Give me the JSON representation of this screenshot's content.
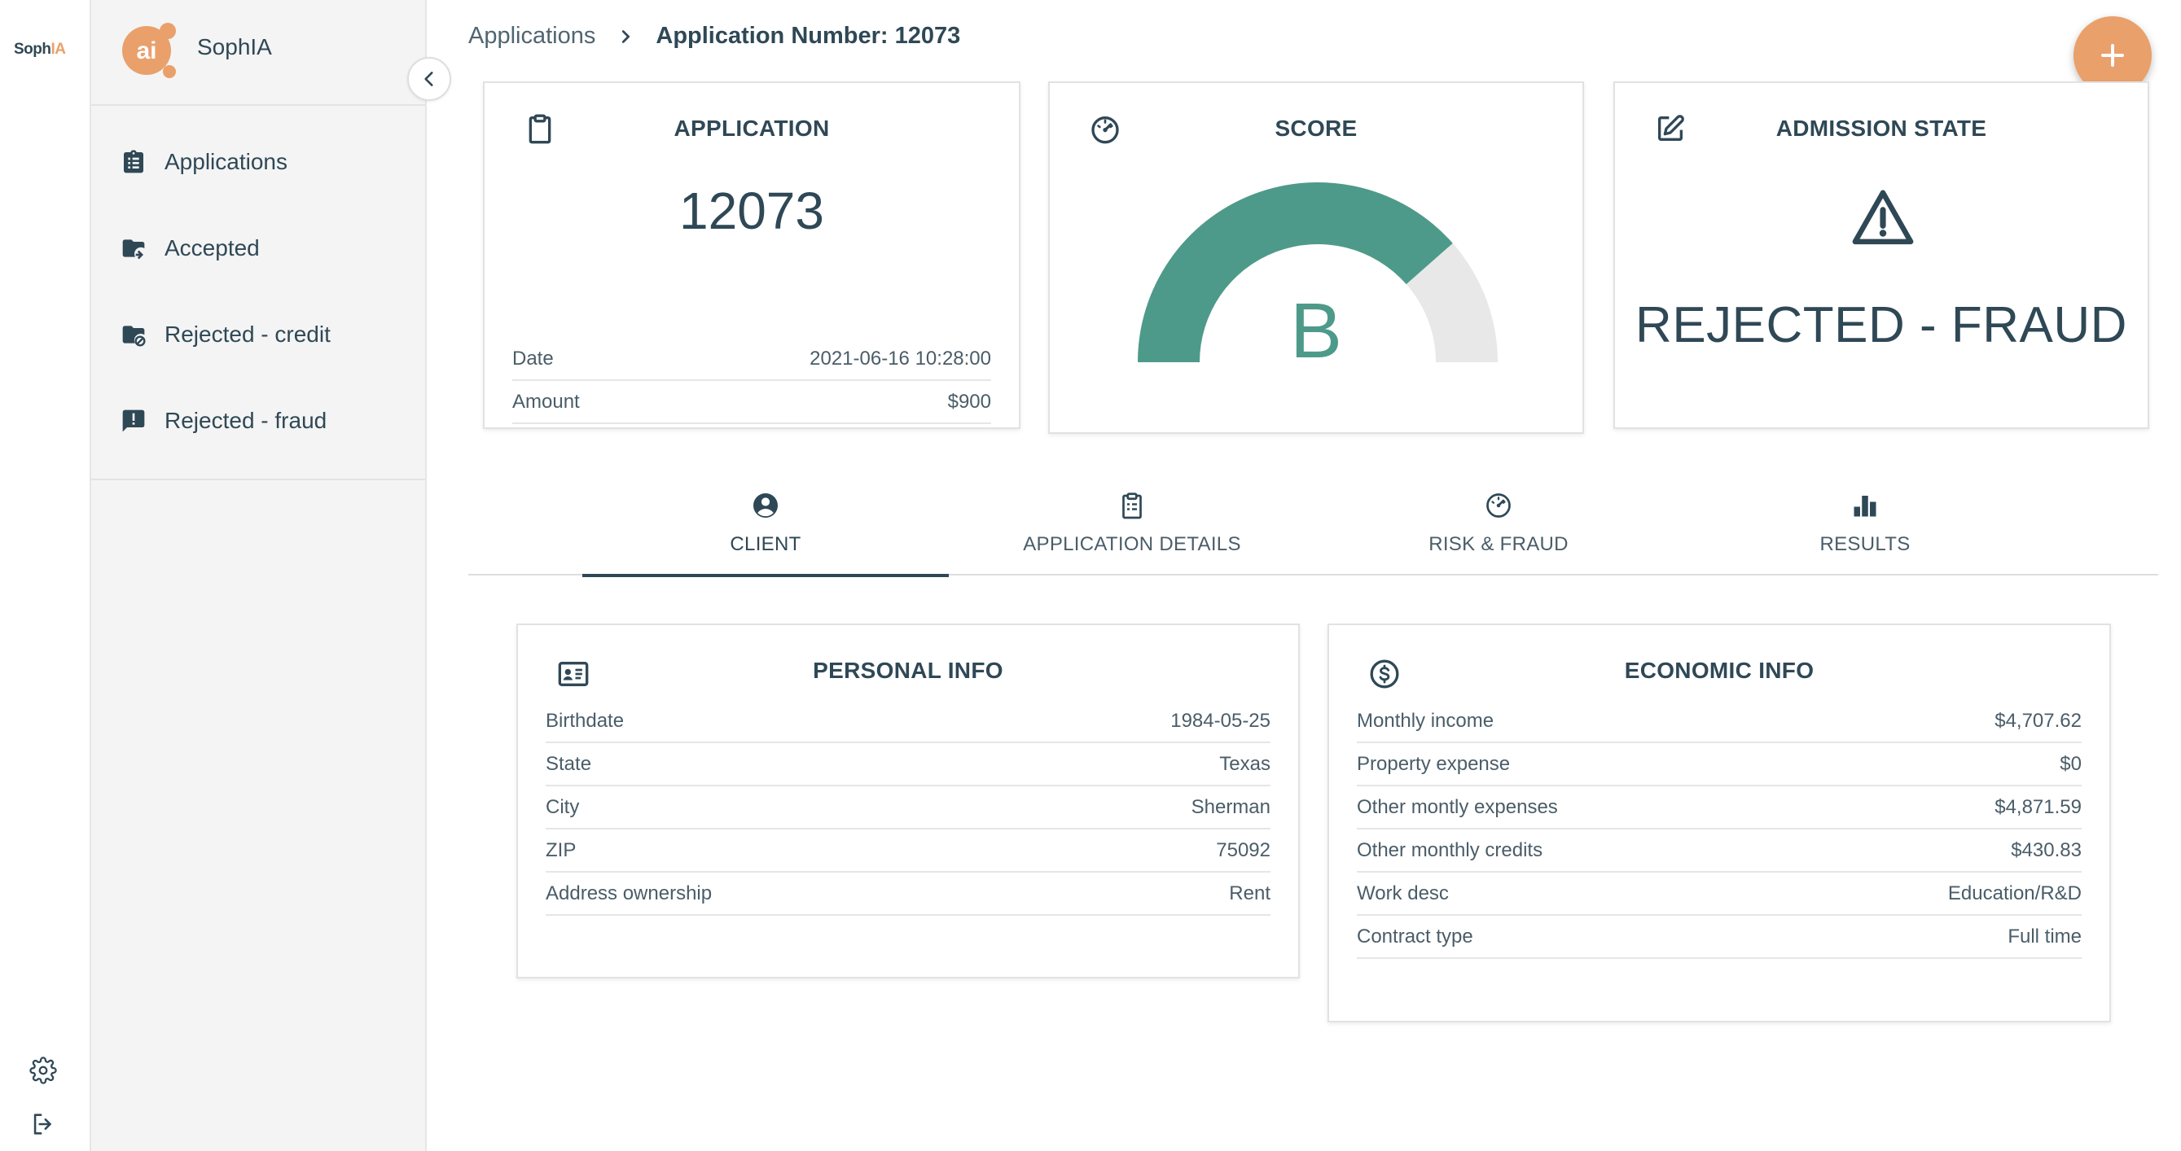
{
  "rail": {
    "logo_text": "Soph",
    "logo_accent": "IA"
  },
  "sidebar": {
    "brand_name": "SophIA",
    "items": [
      {
        "label": "Applications",
        "icon": "clipboard-list-icon"
      },
      {
        "label": "Accepted",
        "icon": "folder-check-icon"
      },
      {
        "label": "Rejected - credit",
        "icon": "folder-block-icon"
      },
      {
        "label": "Rejected - fraud",
        "icon": "report-icon"
      }
    ]
  },
  "breadcrumb": {
    "root": "Applications",
    "current": "Application Number: 12073"
  },
  "application_card": {
    "title": "APPLICATION",
    "number": "12073",
    "rows": [
      {
        "label": "Date",
        "value": "2021-06-16 10:28:00"
      },
      {
        "label": "Amount",
        "value": "$900"
      }
    ]
  },
  "score_card": {
    "title": "SCORE",
    "grade": "B",
    "gauge_fraction": 0.77,
    "gauge_color": "#4e9a8a",
    "gauge_track_color": "#e8e8e8"
  },
  "admission_card": {
    "title": "ADMISSION STATE",
    "state": "REJECTED - FRAUD"
  },
  "tabs": [
    {
      "label": "CLIENT",
      "icon": "account-circle-icon",
      "active": true
    },
    {
      "label": "APPLICATION DETAILS",
      "icon": "clipboard-icon",
      "active": false
    },
    {
      "label": "RISK & FRAUD",
      "icon": "speedometer-icon",
      "active": false
    },
    {
      "label": "RESULTS",
      "icon": "bar-chart-icon",
      "active": false
    }
  ],
  "personal_info": {
    "title": "PERSONAL INFO",
    "rows": [
      {
        "label": "Birthdate",
        "value": "1984-05-25"
      },
      {
        "label": "State",
        "value": "Texas"
      },
      {
        "label": "City",
        "value": "Sherman"
      },
      {
        "label": "ZIP",
        "value": "75092"
      },
      {
        "label": "Address ownership",
        "value": "Rent"
      }
    ]
  },
  "economic_info": {
    "title": "ECONOMIC INFO",
    "rows": [
      {
        "label": "Monthly income",
        "value": "$4,707.62"
      },
      {
        "label": "Property expense",
        "value": "$0"
      },
      {
        "label": "Other montly expenses",
        "value": "$4,871.59"
      },
      {
        "label": "Other monthly credits",
        "value": "$430.83"
      },
      {
        "label": "Work desc",
        "value": "Education/R&D"
      },
      {
        "label": "Contract type",
        "value": "Full time"
      }
    ]
  },
  "colors": {
    "primary": "#2f4856",
    "accent": "#e9a06b",
    "gauge": "#4e9a8a"
  }
}
